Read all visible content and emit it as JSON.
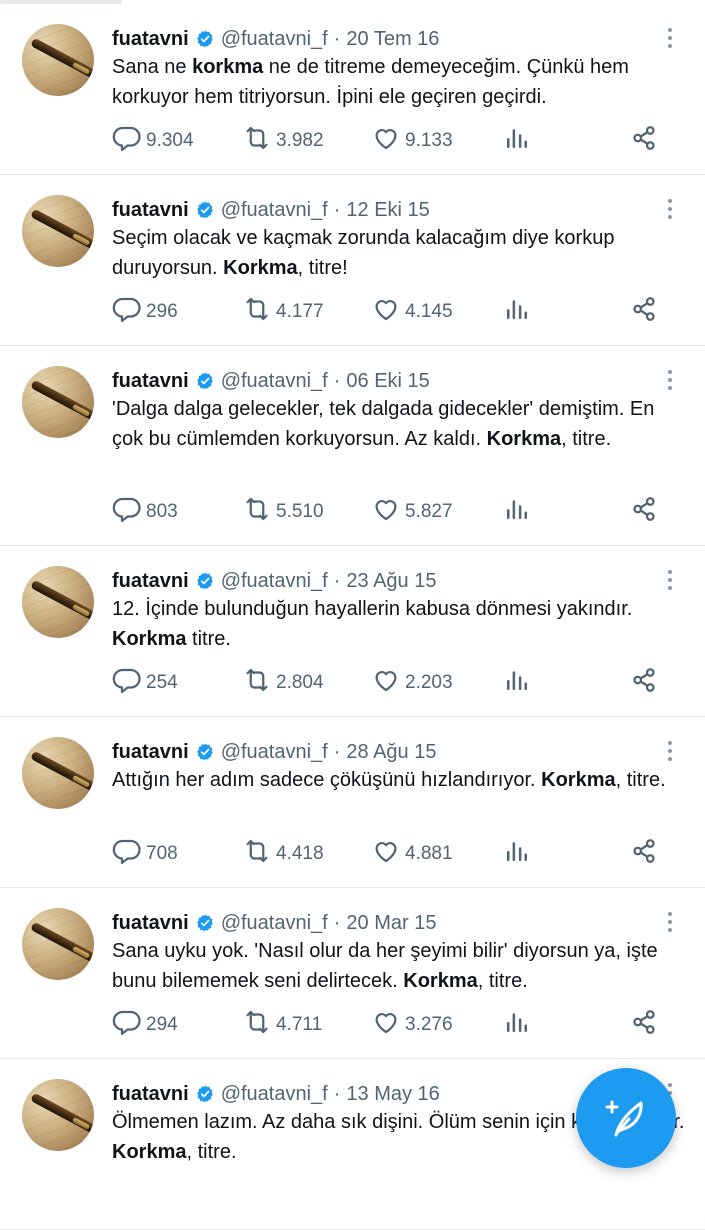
{
  "author": {
    "name": "fuatavni",
    "handle": "@fuatavni_f"
  },
  "tweets": [
    {
      "date": "20 Tem 16",
      "segments": [
        {
          "t": "Sana ne "
        },
        {
          "t": "korkma",
          "b": true
        },
        {
          "t": " ne de titreme demeyeceğim. Çünkü hem korkuyor hem titriyorsun. İpini ele geçiren geçirdi."
        }
      ],
      "replies": "9.304",
      "retweets": "3.982",
      "likes": "9.133"
    },
    {
      "date": "12 Eki 15",
      "segments": [
        {
          "t": "Seçim olacak ve kaçmak zorunda kalacağım diye korkup duruyorsun. "
        },
        {
          "t": "Korkma",
          "b": true
        },
        {
          "t": ", titre!"
        }
      ],
      "replies": "296",
      "retweets": "4.177",
      "likes": "4.145"
    },
    {
      "date": "06 Eki 15",
      "segments": [
        {
          "t": "'Dalga dalga gelecekler, tek dalgada gidecekler' demiştim. En çok bu cümlemden korkuyorsun. Az kaldı. "
        },
        {
          "t": "Korkma",
          "b": true
        },
        {
          "t": ", titre."
        }
      ],
      "replies": "803",
      "retweets": "5.510",
      "likes": "5.827"
    },
    {
      "date": "23 Ağu 15",
      "segments": [
        {
          "t": "12. İçinde bulunduğun hayallerin kabusa dönmesi yakındır. "
        },
        {
          "t": "Korkma",
          "b": true
        },
        {
          "t": " titre."
        }
      ],
      "replies": "254",
      "retweets": "2.804",
      "likes": "2.203"
    },
    {
      "date": "28 Ağu 15",
      "segments": [
        {
          "t": "Attığın her adım sadece çöküşünü hızlandırıyor. "
        },
        {
          "t": "Korkma",
          "b": true
        },
        {
          "t": ", titre."
        }
      ],
      "replies": "708",
      "retweets": "4.418",
      "likes": "4.881"
    },
    {
      "date": "20 Mar 15",
      "segments": [
        {
          "t": "Sana uyku yok. 'Nasıl olur da her şeyimi bilir' diyorsun ya, işte bunu bilememek seni delirtecek. "
        },
        {
          "t": "Korkma",
          "b": true
        },
        {
          "t": ", titre."
        }
      ],
      "replies": "294",
      "retweets": "4.711",
      "likes": "3.276"
    },
    {
      "date": "13 May 16",
      "segments": [
        {
          "t": "Ölmemen lazım. Az daha sık dişini. Ölüm senin için kurtuluş olur. "
        },
        {
          "t": "Korkma",
          "b": true
        },
        {
          "t": ", titre."
        }
      ]
    }
  ],
  "icons": {
    "reply": "reply-icon",
    "retweet": "retweet-icon",
    "like": "heart-icon",
    "views": "views-icon",
    "share": "share-icon",
    "more": "more-vertical-icon",
    "verified": "verified-badge-icon",
    "compose": "compose-icon"
  },
  "colors": {
    "accent": "#1d9bf0",
    "muted": "#536471",
    "text": "#0f1419",
    "divider": "#e7e9ea"
  }
}
